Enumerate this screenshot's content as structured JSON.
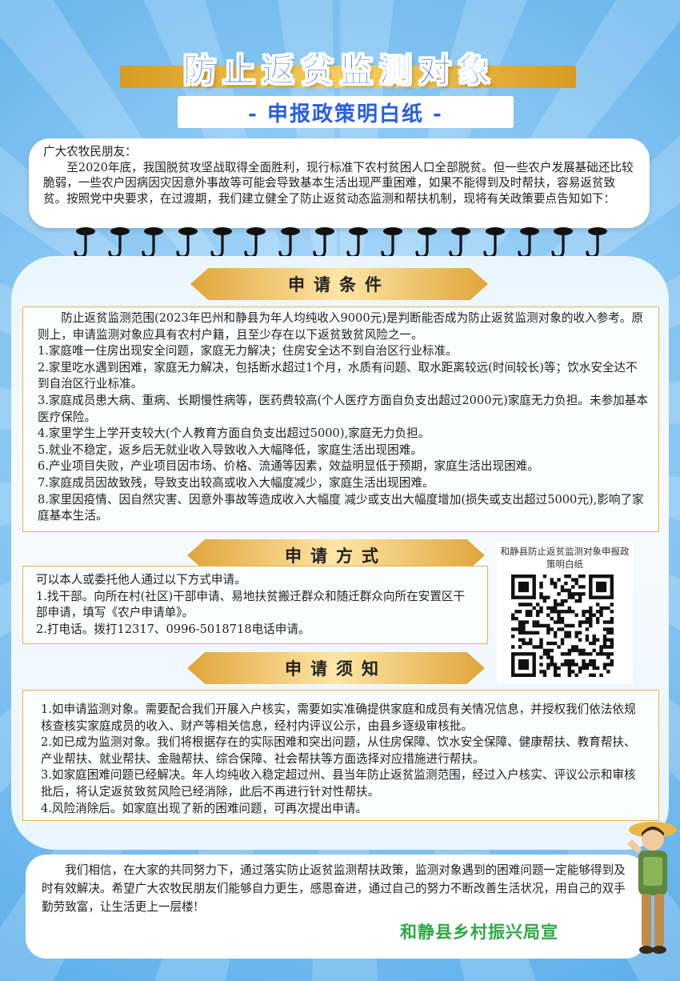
{
  "header": {
    "title": "防止返贫监测对象",
    "subtitle": "- 申报政策明白纸 -"
  },
  "intro": {
    "greeting": "广大农牧民朋友：",
    "body": "至2020年底，我国脱贫攻坚战取得全面胜利，现行标准下农村贫困人口全部脱贫。但一些农户发展基础还比较脆弱，一些农户因病因灾因意外事故等可能会导致基本生活出现严重困难，如果不能得到及时帮扶，容易返贫致贫。按照党中央要求，在过渡期，我们建立健全了防止返贫动态监测和帮扶机制，现将有关政策要点告知如下："
  },
  "conditions": {
    "heading": "申请条件",
    "lead": "防止返贫监测范围(2023年巴州和静县为年人均纯收入9000元)是判断能否成为防止返贫监测对象的收入参考。原则上，申请监测对象应具有农村户籍，且至少存在以下返贫致贫风险之一。",
    "items": [
      "1.家庭唯一住房出现安全问题，家庭无力解决；住房安全达不到自治区行业标准。",
      "2.家里吃水遇到困难，家庭无力解决，包括断水超过1个月，水质有问题、取水距离较远(时间较长)等；饮水安全达不到自治区行业标准。",
      "3.家庭成员患大病、重病、长期慢性病等，医药费较高(个人医疗方面自负支出超过2000元)家庭无力负担。未参加基本医疗保险。",
      "4.家里学生上学开支较大(个人教育方面自负支出超过5000),家庭无力负担。",
      "5.就业不稳定，返乡后无就业收入导致收入大幅降低，家庭生活出现困难。",
      "6.产业项目失败，产业项目因市场、价格、流通等因素，效益明显低于预期，家庭生活出现困难。",
      "7.家庭成员因故致残，导致支出较高或收入大幅度减少，家庭生活出现困难。",
      "8.家里因疫情、因自然灾害、因意外事故等造成收入大幅度 减少或支出大幅度增加(损失或支出超过5000元),影响了家庭基本生活。"
    ]
  },
  "methods": {
    "heading": "申请方式",
    "lines": [
      "可以本人或委托他人通过以下方式申请。",
      "1.找干部。向所在村(社区)干部申请、易地扶贫搬迁群众和随迁群众向所在安置区干部申请，填写《农户申请单》。",
      "2.打电话。拨打12317、0996-5018718电话申请。"
    ]
  },
  "qr": {
    "caption": "和静县防止返贫监测对象申报政策明白纸"
  },
  "notes": {
    "heading": "申请须知",
    "items": [
      "1.如申请监测对象。需要配合我们开展入户核实，需要如实准确提供家庭和成员有关情况信息，并授权我们依法依规核查核实家庭成员的收入、财产等相关信息，经村内评议公示，由县乡逐级审核批。",
      "2.如已成为监测对象。我们将根据存在的实际困难和突出问题，从住房保障、饮水安全保障、健康帮扶、教育帮扶、产业帮扶、就业帮扶、金融帮扶、综合保障、社会帮扶等方面选择对应措施进行帮扶。",
      "3.如家庭困难问题已经解决。年人均纯收入稳定超过州、县当年防止返贫监测范围，经过入户核实、评议公示和审核批后，将认定返贫致贫风险已经消除，此后不再进行针对性帮扶。",
      "4.风险消除后。如家庭出现了新的困难问题，可再次提出申请。"
    ]
  },
  "closing": {
    "body": "我们相信，在大家的共同努力下，通过落实防止返贫监测帮扶政策，监测对象遇到的困难问题一定能够得到及时有效解决。希望广大农牧民朋友们能够自力更生，感恩奋进，通过自己的努力不断改善生活状况，用自己的双手勤劳致富，让生活更上一层楼!",
    "signature": "和静县乡村振兴局宣"
  },
  "colors": {
    "title_blue": "#2d5fd8",
    "gold": "#e0a53a",
    "signature_green": "#2ea845",
    "background_blue": "#5aaeea"
  }
}
